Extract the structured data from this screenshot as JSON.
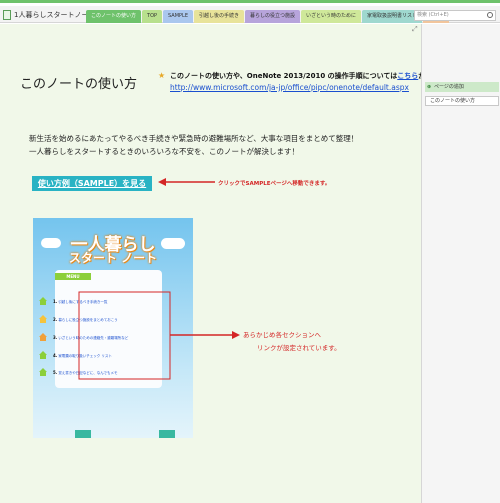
{
  "notebook": {
    "title": "1人暮らしスタートノート"
  },
  "tabs": [
    {
      "label": "このノートの使い方",
      "color": "#6ec26b",
      "active": true
    },
    {
      "label": "TOP",
      "color": "#b8e08d"
    },
    {
      "label": "SAMPLE",
      "color": "#aac7ee"
    },
    {
      "label": "引越し後の手続き",
      "color": "#e8e39a"
    },
    {
      "label": "暮らしの役立つ施設",
      "color": "#b7a4db"
    },
    {
      "label": "いざという時のために",
      "color": "#cfe89a"
    },
    {
      "label": "家電取扱説明書リスト",
      "color": "#9fd8cf"
    },
    {
      "label": "MEMO",
      "color": "#f2c59c"
    }
  ],
  "search": {
    "placeholder": "検索 (Ctrl+E)"
  },
  "page": {
    "title": "このノートの使い方",
    "note_text": "このノートの使い方や、OneNote 2013/2010 の操作手順については",
    "note_link": "こちら",
    "note_suffix": "から",
    "url": "http://www.microsoft.com/ja-jp/office/pipc/onenote/default.aspx",
    "body_line_1": "新生活を始めるにあたってやるべき手続きや緊急時の避難場所など、大事な項目をまとめて整理！",
    "body_line_2": "一人暮らしをスタートするときのいろいろな不安を、このノートが解決します！",
    "cta_button": "使い方例（SAMPLE）を見る",
    "cta_annotation": "クリックでSAMPLEページへ移動できます。",
    "annotation_line_1": "あらかじめ各セクションへ",
    "annotation_line_2": "リンクが設定されています。"
  },
  "cover": {
    "title_line_1": "一人暮らし",
    "title_line_2": "スタート ノート",
    "menu_label": "MENU",
    "menu_items": [
      {
        "num": "1.",
        "label": "引越し後にするべき手続き一覧"
      },
      {
        "num": "2.",
        "label": "暮らしに役立つ施設をまとめておこう"
      },
      {
        "num": "3.",
        "label": "いざという時のための連絡先・避難場所など"
      },
      {
        "num": "4.",
        "label": "家電類の取り扱いチェック リスト"
      },
      {
        "num": "5.",
        "label": "覚え書きや日記などに、なんでもメモ"
      }
    ],
    "house_colors": [
      "#8ccf3a",
      "#f5c33b",
      "#f0a03a",
      "#8ccf3a",
      "#8ccf3a"
    ]
  },
  "page_panel": {
    "add_page": "ページの追加",
    "pages": [
      "このノートの使い方"
    ]
  },
  "colors": {
    "accent": "#6ec26b",
    "link": "#1a4fcf",
    "annotation": "#d42626",
    "cta": "#29b3c4"
  }
}
